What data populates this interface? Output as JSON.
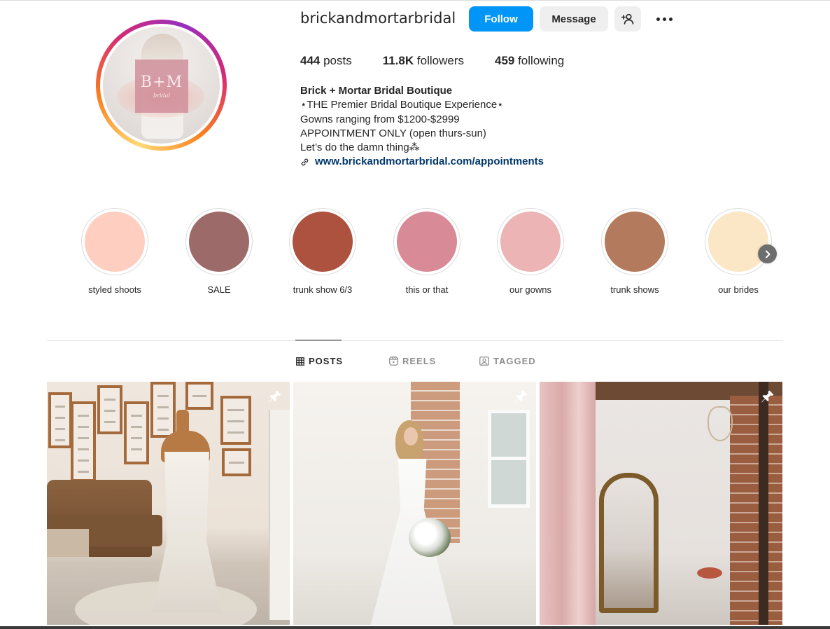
{
  "profile": {
    "username": "brickandmortarbridal",
    "avatar_logo": "B+M",
    "avatar_logo_sub": "bridal",
    "buttons": {
      "follow": "Follow",
      "message": "Message",
      "suggest_icon": "person-plus-icon",
      "more_icon": "more-options-icon"
    },
    "stats": {
      "posts_count": "444",
      "posts_label": " posts",
      "followers_count": "11.8K",
      "followers_label": " followers",
      "following_count": "459",
      "following_label": " following"
    },
    "bio": {
      "name": "Brick + Mortar Bridal Boutique",
      "line1": "⋆THE Premier Bridal Boutique Experience⋆",
      "line2": "Gowns ranging from $1200-$2999",
      "line3": "APPOINTMENT ONLY (open thurs-sun)",
      "line4": "Let’s do the damn thing⁂",
      "link": "www.brickandmortarbridal.com/appointments",
      "link_icon": "link-icon"
    }
  },
  "highlights": [
    {
      "label": "styled shoots",
      "color": "#fecfc1"
    },
    {
      "label": "SALE",
      "color": "#9d6a6a"
    },
    {
      "label": "trunk show 6/3",
      "color": "#ad523e"
    },
    {
      "label": "this or that",
      "color": "#d88a96"
    },
    {
      "label": "our gowns",
      "color": "#ecb4b4"
    },
    {
      "label": "trunk shows",
      "color": "#b37a5d"
    },
    {
      "label": "our brides",
      "color": "#fbe6c6"
    }
  ],
  "highlights_next_icon": "chevron-right-icon",
  "tabs": {
    "posts": "POSTS",
    "reels": "REELS",
    "tagged": "TAGGED",
    "active": "posts"
  },
  "posts": [
    {
      "pinned": true,
      "alt": "wedding gown on dress form in boutique"
    },
    {
      "pinned": true,
      "alt": "bride holding bouquet by window"
    },
    {
      "pinned": true,
      "alt": "boutique fitting room with arched mirror"
    }
  ],
  "colors": {
    "accent": "#0095f6",
    "link": "#00376b",
    "text": "#262626",
    "muted": "#8e8e8e"
  }
}
